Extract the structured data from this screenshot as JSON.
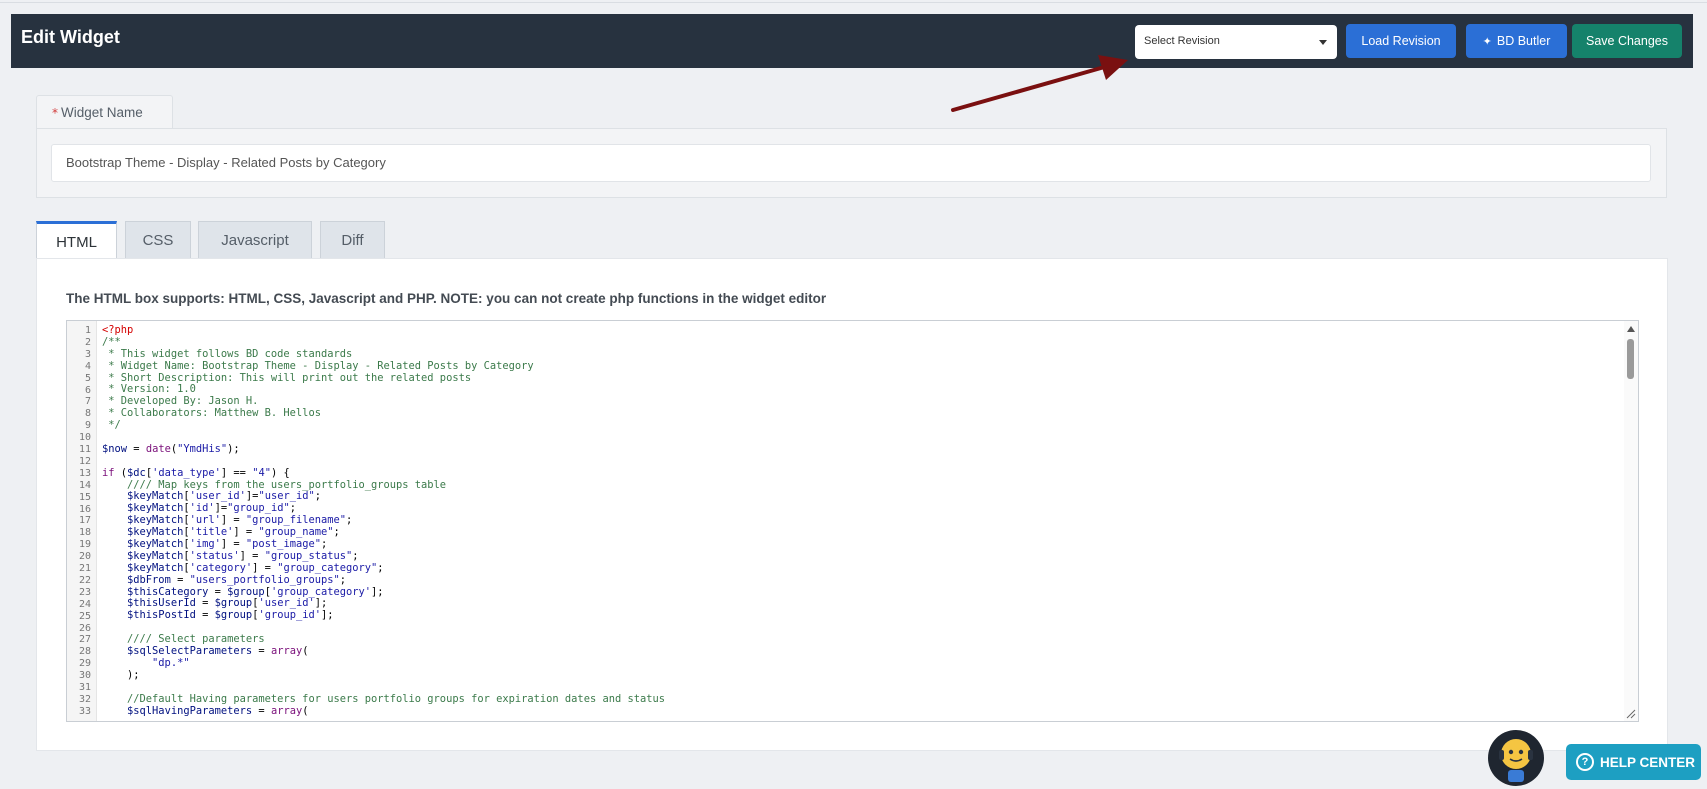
{
  "header": {
    "title": "Edit Widget",
    "revision_select": "Select Revision",
    "load_revision": "Load Revision",
    "bd_butler": "BD Butler",
    "save_changes": "Save Changes"
  },
  "widget_name": {
    "required_mark": "*",
    "label": "Widget Name",
    "value": "Bootstrap Theme - Display - Related Posts by Category"
  },
  "tabs": [
    {
      "label": "HTML",
      "active": true
    },
    {
      "label": "CSS",
      "active": false
    },
    {
      "label": "Javascript",
      "active": false
    },
    {
      "label": "Diff",
      "active": false
    }
  ],
  "editor": {
    "help_text": "The HTML box supports: HTML, CSS, Javascript and PHP. NOTE: you can not create php functions in the widget editor",
    "lines": [
      "<?php",
      "/**",
      " * This widget follows BD code standards",
      " * Widget Name: Bootstrap Theme - Display - Related Posts by Category",
      " * Short Description: This will print out the related posts",
      " * Version: 1.0",
      " * Developed By: Jason H.",
      " * Collaborators: Matthew B. Hellos",
      " */",
      "",
      "$now = date(\"YmdHis\");",
      "",
      "if ($dc['data_type'] == \"4\") {",
      "    //// Map keys from the users_portfolio_groups table",
      "    $keyMatch['user_id']=\"user_id\";",
      "    $keyMatch['id']=\"group_id\";",
      "    $keyMatch['url'] = \"group_filename\";",
      "    $keyMatch['title'] = \"group_name\";",
      "    $keyMatch['img'] = \"post_image\";",
      "    $keyMatch['status'] = \"group_status\";",
      "    $keyMatch['category'] = \"group_category\";",
      "    $dbFrom = \"users_portfolio_groups\";",
      "    $thisCategory = $group['group_category'];",
      "    $thisUserId = $group['user_id'];",
      "    $thisPostId = $group['group_id'];",
      "",
      "    //// Select parameters",
      "    $sqlSelectParameters = array(",
      "        \"dp.*\"",
      "    );",
      "",
      "    //Default Having parameters for users portfolio groups for expiration dates and status",
      "    $sqlHavingParameters = array("
    ]
  },
  "help_center": "HELP CENTER",
  "colors": {
    "header_bg": "#27323f",
    "primary": "#2b6fd6",
    "save": "#15826b",
    "help": "#1d9fc2",
    "annotation_arrow": "#7a1010"
  }
}
